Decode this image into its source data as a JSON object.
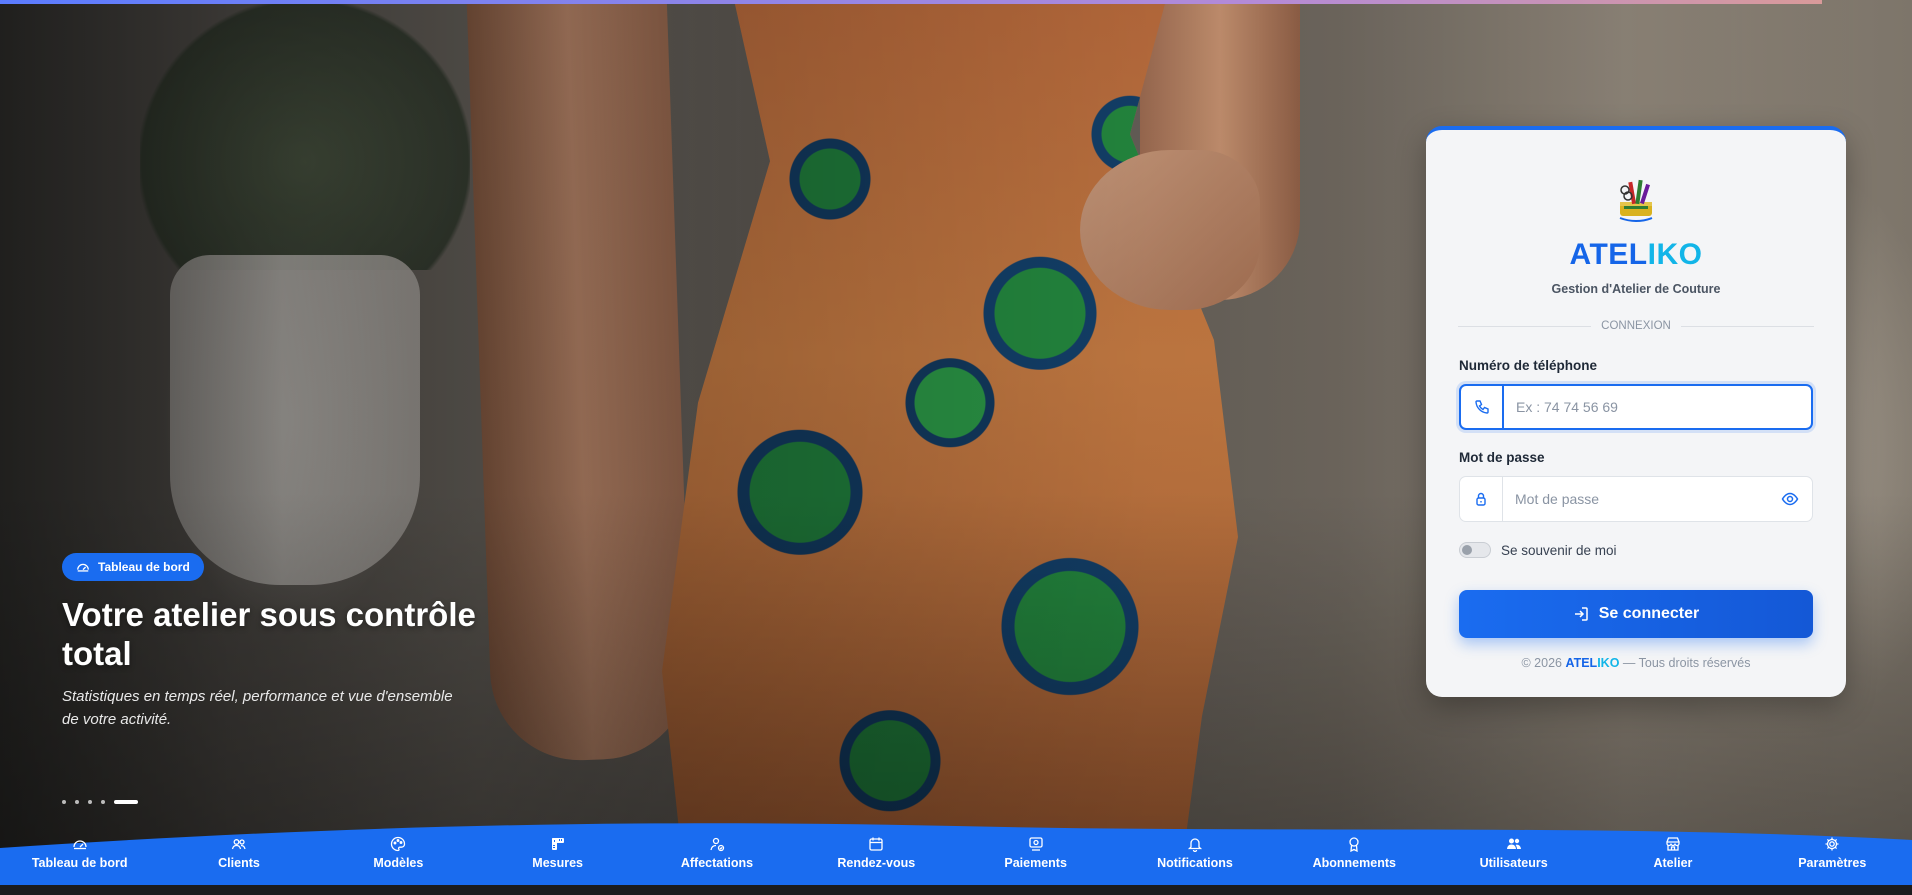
{
  "hero": {
    "badge": "Tableau de bord",
    "title": "Votre atelier sous contrôle total",
    "description": "Statistiques en temps réel, performance et vue d'ensemble de votre activité.",
    "slides_total": 5,
    "active_slide": 5
  },
  "login": {
    "brand_part1": "ATEL",
    "brand_part2": "IKO",
    "subtitle": "Gestion d'Atelier de Couture",
    "section": "CONNEXION",
    "phone_label": "Numéro de téléphone",
    "phone_placeholder": "Ex : 74 74 56 69",
    "password_label": "Mot de passe",
    "password_placeholder": "Mot de passe",
    "remember_label": "Se souvenir de moi",
    "remember_checked": false,
    "submit_label": "Se connecter",
    "footer_prefix": "© 2026",
    "footer_brand1": "ATEL",
    "footer_brand2": "IKO",
    "footer_suffix": "— Tous droits réservés"
  },
  "nav": {
    "items": [
      {
        "label": "Tableau de bord",
        "icon": "gauge-icon"
      },
      {
        "label": "Clients",
        "icon": "users-outline-icon"
      },
      {
        "label": "Modèles",
        "icon": "palette-icon"
      },
      {
        "label": "Mesures",
        "icon": "ruler-icon"
      },
      {
        "label": "Affectations",
        "icon": "user-assign-icon"
      },
      {
        "label": "Rendez-vous",
        "icon": "calendar-icon"
      },
      {
        "label": "Paiements",
        "icon": "payment-icon"
      },
      {
        "label": "Notifications",
        "icon": "bell-icon"
      },
      {
        "label": "Abonnements",
        "icon": "award-icon"
      },
      {
        "label": "Utilisateurs",
        "icon": "people-icon"
      },
      {
        "label": "Atelier",
        "icon": "shop-icon"
      },
      {
        "label": "Paramètres",
        "icon": "gear-icon"
      }
    ]
  },
  "colors": {
    "primary": "#1a6cf0",
    "brand_dark": "#1565e8",
    "brand_light": "#12b5e8",
    "card_bg": "#f4f5f7"
  }
}
